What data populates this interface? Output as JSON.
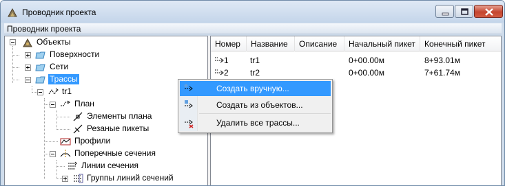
{
  "window": {
    "title": "Проводник проекта"
  },
  "menubar": {
    "label": "Проводник проекта"
  },
  "tree": {
    "root": "Объекты",
    "surfaces": "Поверхности",
    "networks": "Сети",
    "alignments": "Трассы",
    "tr1": "tr1",
    "plan": "План",
    "plan_elements": "Элементы плана",
    "cut_stations": "Резаные пикеты",
    "profiles": "Профили",
    "cross_sections": "Поперечные сечения",
    "section_lines": "Линии сечения",
    "section_line_groups": "Группы линий сечений"
  },
  "list": {
    "columns": [
      "Номер",
      "Название",
      "Описание",
      "Начальный пикет",
      "Конечный пикет"
    ],
    "rows": [
      {
        "number": "1",
        "name": "tr1",
        "description": "",
        "start": "0+00.00м",
        "end": "8+93.01м"
      },
      {
        "number": "2",
        "name": "tr2",
        "description": "",
        "start": "0+00.00м",
        "end": "7+61.74м"
      }
    ]
  },
  "context_menu": {
    "items": [
      "Создать вручную...",
      "Создать из объектов...",
      "Удалить все трассы..."
    ]
  },
  "colors": {
    "selection": "#3399ff",
    "titlebar": "#cfdceb",
    "close_button": "#c44530"
  }
}
